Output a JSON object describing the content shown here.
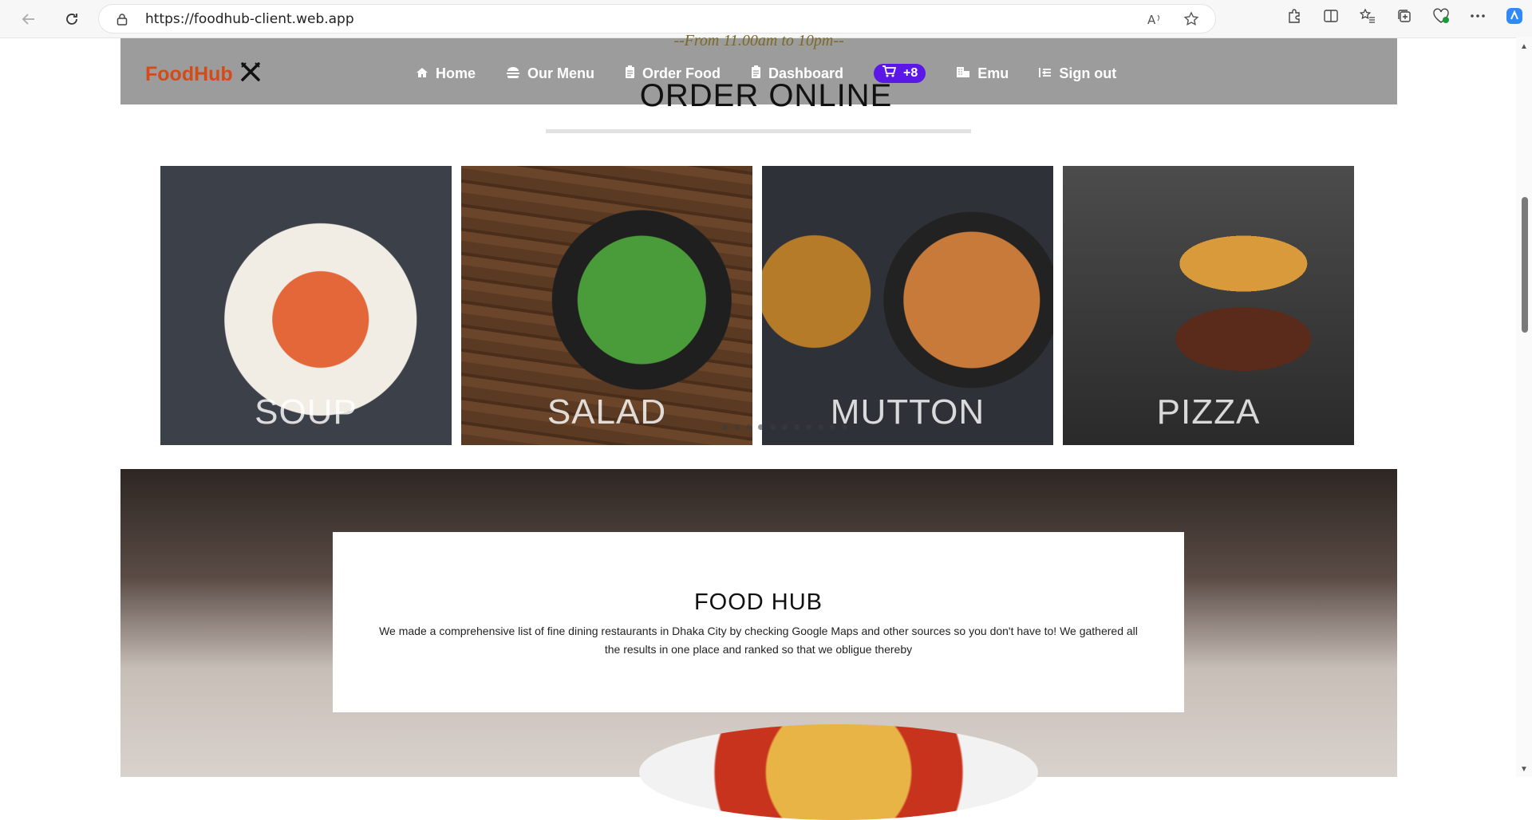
{
  "browser": {
    "url": "https://foodhub-client.web.app"
  },
  "site": {
    "hours": "--From 11.00am to 10pm--",
    "logo_food": "Food",
    "logo_hub": "Hub",
    "nav": {
      "home": "Home",
      "menu": "Our Menu",
      "order": "Order Food",
      "dashboard": "Dashboard",
      "cart_count": "+8",
      "user": "Emu",
      "signout": "Sign out"
    },
    "section_title": "ORDER ONLINE",
    "cards": [
      {
        "label": "SOUP"
      },
      {
        "label": "SALAD"
      },
      {
        "label": "MUTTON"
      },
      {
        "label": "PIZZA"
      }
    ],
    "about": {
      "title": "FOOD HUB",
      "text": "We made a comprehensive list of fine dining restaurants in Dhaka City by checking Google Maps and other sources so you don't have to! We gathered all the results in one place and ranked so that we obligue thereby"
    }
  },
  "colors": {
    "nav_bg": "#9c9c9c",
    "logo": "#d44b1a",
    "cart_badge": "#5b16e8"
  }
}
